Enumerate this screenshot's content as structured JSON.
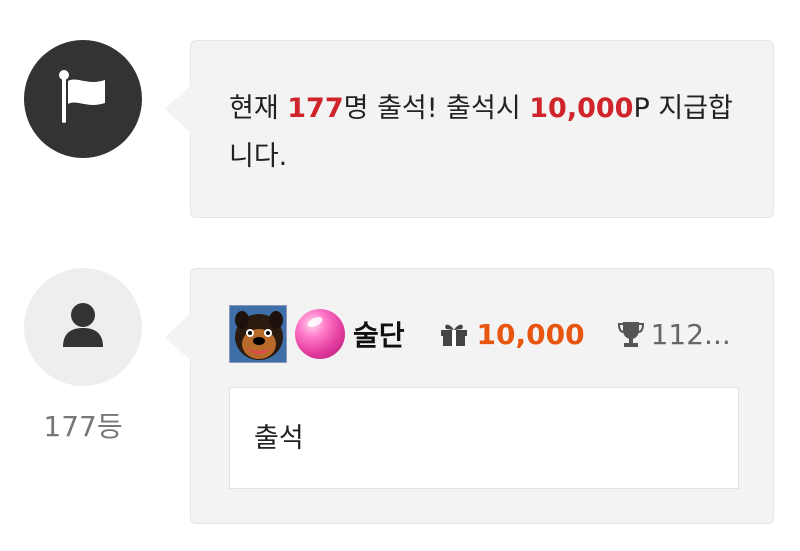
{
  "notice": {
    "icon": "flag-icon",
    "text_prefix": "현재 ",
    "count": "177",
    "text_middle": "명 출석! 출석시 ",
    "points": "10,000",
    "text_suffix": "P 지급합니다.",
    "highlight_color": "#d0242b"
  },
  "comment": {
    "avatar_icon": "user-icon",
    "rank": "177등",
    "nickname": "술단",
    "point_icon": "gift-icon",
    "points": "10,000",
    "trophy_icon": "trophy-icon",
    "trophy_value": "112...",
    "body": "출석",
    "points_color": "#e8550f"
  }
}
